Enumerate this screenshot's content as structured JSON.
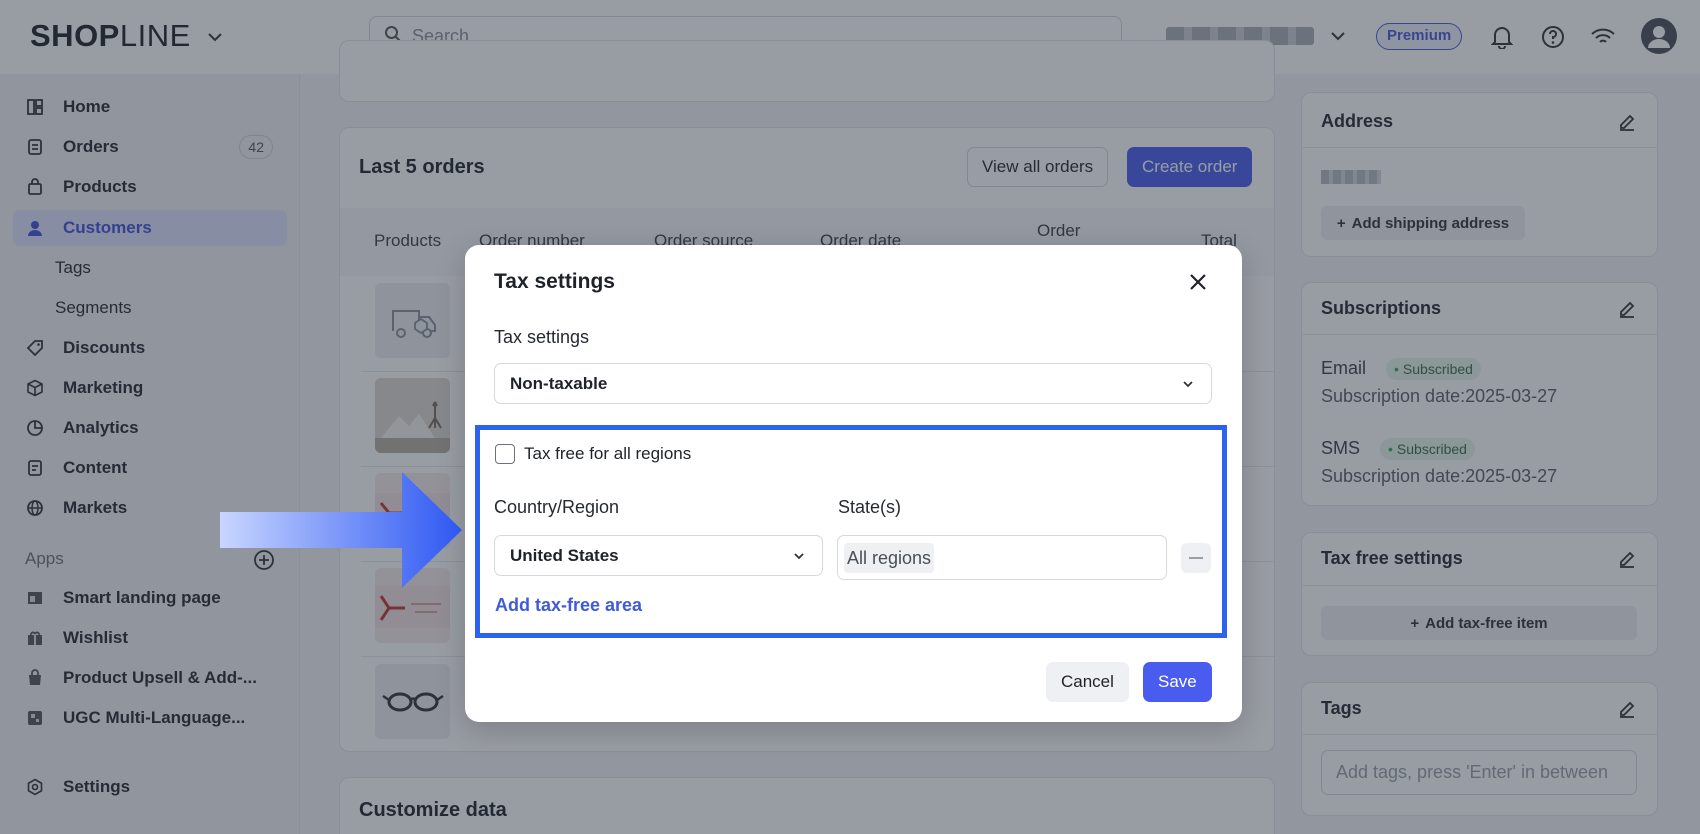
{
  "topbar": {
    "logo_bold": "SHOP",
    "logo_thin": "LINE",
    "search_placeholder": "Search",
    "premium_label": "Premium"
  },
  "sidebar": {
    "items": [
      {
        "label": "Home",
        "icon": "home-icon"
      },
      {
        "label": "Orders",
        "icon": "orders-icon",
        "badge": "42"
      },
      {
        "label": "Products",
        "icon": "bag-icon"
      },
      {
        "label": "Customers",
        "icon": "person-icon",
        "active": true
      },
      {
        "label": "Tags"
      },
      {
        "label": "Segments"
      },
      {
        "label": "Discounts",
        "icon": "tag-icon"
      },
      {
        "label": "Marketing",
        "icon": "cube-icon"
      },
      {
        "label": "Analytics",
        "icon": "pie-icon"
      },
      {
        "label": "Content",
        "icon": "document-icon"
      },
      {
        "label": "Markets",
        "icon": "globe-icon"
      }
    ],
    "apps_label": "Apps",
    "apps": [
      {
        "label": "Smart landing page",
        "icon": "landing-icon"
      },
      {
        "label": "Wishlist",
        "icon": "gift-icon"
      },
      {
        "label": "Product Upsell & Add-...",
        "icon": "upsell-icon"
      },
      {
        "label": "UGC Multi-Language...",
        "icon": "ugc-icon"
      }
    ],
    "settings_label": "Settings"
  },
  "orders_card": {
    "title": "Last 5 orders",
    "view_all_label": "View all orders",
    "create_label": "Create order",
    "columns": [
      "Products",
      "Order number",
      "Order source",
      "Order date",
      "Order",
      "Total"
    ]
  },
  "customize_card": {
    "title": "Customize data"
  },
  "right": {
    "address": {
      "title": "Address",
      "add_label": "Add shipping address"
    },
    "subscriptions": {
      "title": "Subscriptions",
      "email_label": "Email",
      "email_status": "Subscribed",
      "email_date": "Subscription date:2025-03-27",
      "sms_label": "SMS",
      "sms_status": "Subscribed",
      "sms_date": "Subscription date:2025-03-27"
    },
    "tax_free": {
      "title": "Tax free settings",
      "add_label": "Add tax-free item"
    },
    "tags": {
      "title": "Tags",
      "placeholder": "Add tags, press 'Enter' in between"
    }
  },
  "modal": {
    "title": "Tax settings",
    "field_label": "Tax settings",
    "selected": "Non-taxable",
    "checkbox_label": "Tax free for all regions",
    "country_label": "Country/Region",
    "state_label": "State(s)",
    "country_value": "United States",
    "state_chip": "All regions",
    "add_area_link": "Add tax-free area",
    "cancel_label": "Cancel",
    "save_label": "Save"
  },
  "colors": {
    "accent": "#4a5cf0",
    "highlight": "#2b63f0",
    "link": "#3f5bd8"
  }
}
